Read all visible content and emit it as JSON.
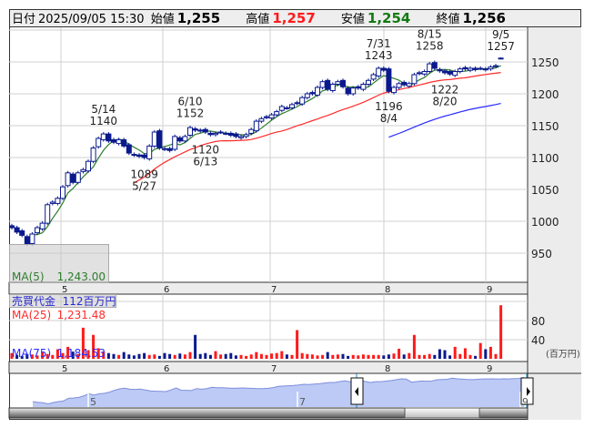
{
  "header": {
    "date_label": "日付",
    "datetime": "2025/09/05 15:30",
    "open_label": "始値",
    "open": "1,255",
    "high_label": "高値",
    "high": "1,257",
    "low_label": "安値",
    "low": "1,254",
    "close_label": "終値",
    "close": "1,256"
  },
  "legend": {
    "ma5_label": "MA(5)",
    "ma5_value": "1,243.00",
    "ma25_label": "MA(25)",
    "ma25_value": "1,231.48",
    "ma75_label": "MA(75)",
    "ma75_value": "1,184.53"
  },
  "volume_legend": {
    "label": "売買代金",
    "value": "112百万円"
  },
  "volume_unit": "(百万円)",
  "colors": {
    "ma5": "#2e7d2e",
    "ma25": "#ff2a2a",
    "ma75": "#2a2aff",
    "candle": "#0a1a8c",
    "vol_up": "#ff1a1a",
    "vol_down": "#0a1a8c",
    "nav_fill": "#bccaf5",
    "nav_line": "#7f8fdc"
  },
  "chart_data": {
    "type": "candlestick",
    "price_ticks": [
      "950",
      "1000",
      "1050",
      "1100",
      "1150",
      "1200",
      "1250"
    ],
    "price_tick_values": [
      950,
      1000,
      1050,
      1100,
      1150,
      1200,
      1250
    ],
    "month_labels": [
      "5",
      "6",
      "7",
      "8",
      "9"
    ],
    "nav_month_labels": [
      "5",
      "7",
      "9"
    ],
    "volume_ticks": [
      "40",
      "80"
    ],
    "volume_tick_values": [
      40,
      80
    ],
    "closes": [
      990,
      983,
      978,
      965,
      980,
      990,
      997,
      1026,
      1030,
      1036,
      1054,
      1076,
      1061,
      1076,
      1081,
      1094,
      1115,
      1130,
      1137,
      1126,
      1124,
      1128,
      1118,
      1107,
      1104,
      1102,
      1100,
      1118,
      1140,
      1115,
      1114,
      1111,
      1133,
      1126,
      1133,
      1147,
      1143,
      1142,
      1140,
      1136,
      1138,
      1140,
      1138,
      1135,
      1133,
      1133,
      1136,
      1144,
      1157,
      1161,
      1164,
      1167,
      1172,
      1180,
      1178,
      1183,
      1186,
      1194,
      1200,
      1200,
      1210,
      1219,
      1207,
      1215,
      1219,
      1211,
      1200,
      1209,
      1209,
      1215,
      1221,
      1230,
      1240,
      1237,
      1204,
      1210,
      1216,
      1214,
      1216,
      1230,
      1233,
      1235,
      1247,
      1240,
      1236,
      1233,
      1231,
      1235,
      1239,
      1239,
      1240,
      1238,
      1240,
      1239,
      1242,
      1244,
      1256
    ],
    "volumes": [
      12,
      8,
      6,
      10,
      9,
      7,
      14,
      10,
      8,
      20,
      12,
      25,
      15,
      10,
      65,
      18,
      50,
      22,
      15,
      12,
      10,
      8,
      14,
      9,
      7,
      10,
      12,
      8,
      9,
      6,
      12,
      10,
      8,
      11,
      9,
      14,
      50,
      10,
      12,
      8,
      16,
      9,
      10,
      12,
      7,
      8,
      6,
      9,
      14,
      10,
      8,
      11,
      12,
      16,
      9,
      8,
      60,
      12,
      10,
      9,
      7,
      8,
      14,
      8,
      9,
      10,
      6,
      8,
      7,
      9,
      8,
      8,
      8,
      7,
      9,
      11,
      21,
      9,
      12,
      50,
      8,
      8,
      10,
      8,
      20,
      18,
      7,
      25,
      10,
      22,
      8,
      6,
      33,
      20,
      25,
      10,
      112
    ],
    "annotations": [
      {
        "day_index": 18,
        "date": "5/14",
        "value": "1140",
        "kind": "high",
        "price": 1140
      },
      {
        "day_index": 26,
        "date": "5/27",
        "value": "1089",
        "kind": "low",
        "price": 1089
      },
      {
        "day_index": 35,
        "date": "6/10",
        "value": "1152",
        "kind": "high",
        "price": 1152
      },
      {
        "day_index": 38,
        "date": "6/13",
        "value": "1120",
        "kind": "low",
        "price": 1128
      },
      {
        "day_index": 72,
        "date": "7/31",
        "value": "1243",
        "kind": "high",
        "price": 1243
      },
      {
        "day_index": 74,
        "date": "8/4",
        "value": "1196",
        "kind": "low",
        "price": 1196
      },
      {
        "day_index": 82,
        "date": "8/15",
        "value": "1258",
        "kind": "high",
        "price": 1258
      },
      {
        "day_index": 85,
        "date": "8/20",
        "value": "1222",
        "kind": "low",
        "price": 1222
      },
      {
        "day_index": 96,
        "date": "9/5",
        "value": "1257",
        "kind": "high",
        "price": 1257
      }
    ],
    "last_ohlc": [
      1255,
      1257,
      1254,
      1256
    ],
    "ylim": [
      920,
      1290
    ],
    "volume_ylim": [
      0,
      130
    ]
  }
}
